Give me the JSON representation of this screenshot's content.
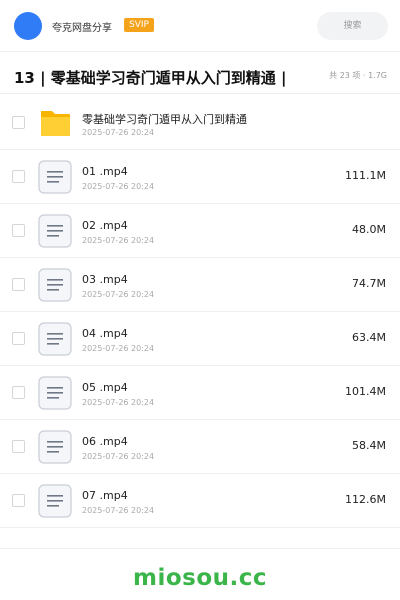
{
  "header": {
    "share_name": "夸克网盘分享",
    "badge": "SVIP",
    "search_placeholder": "搜索",
    "accent": "#2f7cf6",
    "badge_color": "#f5a31a"
  },
  "folder": {
    "title": "13 | 零基础学习奇门遁甲从入门到精通 |",
    "summary": "共 23 项 · 1.7G"
  },
  "files": [
    {
      "name": "零基础学习奇门遁甲从入门到精通",
      "date": "2025-07-26 20:24",
      "size": "",
      "icon": "folder-icon"
    },
    {
      "name": "01 .mp4",
      "date": "2025-07-26 20:24",
      "size": "111.1M",
      "icon": "document-icon"
    },
    {
      "name": "02 .mp4",
      "date": "2025-07-26 20:24",
      "size": "48.0M",
      "icon": "document-icon"
    },
    {
      "name": "03 .mp4",
      "date": "2025-07-26 20:24",
      "size": "74.7M",
      "icon": "document-icon"
    },
    {
      "name": "04 .mp4",
      "date": "2025-07-26 20:24",
      "size": "63.4M",
      "icon": "document-icon"
    },
    {
      "name": "05 .mp4",
      "date": "2025-07-26 20:24",
      "size": "101.4M",
      "icon": "document-icon"
    },
    {
      "name": "06 .mp4",
      "date": "2025-07-26 20:24",
      "size": "58.4M",
      "icon": "document-icon"
    },
    {
      "name": "07 .mp4",
      "date": "2025-07-26 20:24",
      "size": "112.6M",
      "icon": "document-icon"
    }
  ],
  "footer": {
    "watermark": "miosou.cc",
    "watermark_color": "#3bb54a"
  }
}
